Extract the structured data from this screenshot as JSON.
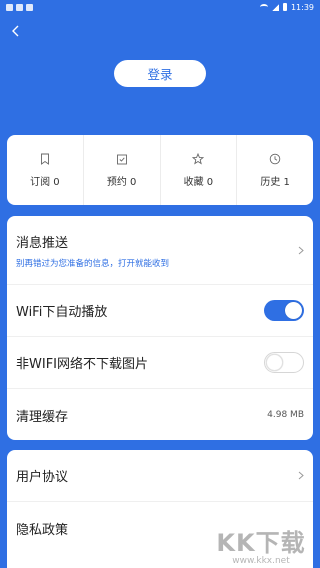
{
  "status_bar": {
    "time": "11:39"
  },
  "header": {
    "login_label": "登录"
  },
  "stats": [
    {
      "icon": "bookmark-icon",
      "label": "订阅 0"
    },
    {
      "icon": "calendar-check-icon",
      "label": "预约 0"
    },
    {
      "icon": "star-icon",
      "label": "收藏 0"
    },
    {
      "icon": "clock-icon",
      "label": "历史 1"
    }
  ],
  "settings": {
    "push": {
      "title": "消息推送",
      "subtitle": "别再错过为您准备的信息，打开就能收到"
    },
    "wifi_autoplay": {
      "title": "WiFi下自动播放",
      "enabled": true
    },
    "no_images_non_wifi": {
      "title": "非WIFI网络不下载图片",
      "enabled": false
    },
    "clear_cache": {
      "title": "清理缓存",
      "value": "4.98 MB"
    }
  },
  "legal": {
    "user_agreement": "用户协议",
    "privacy_policy": "隐私政策"
  },
  "watermark": {
    "text": "KK下载",
    "url": "www.kkx.net"
  },
  "colors": {
    "accent": "#2f6fe3",
    "background": "#2f6fe3"
  }
}
